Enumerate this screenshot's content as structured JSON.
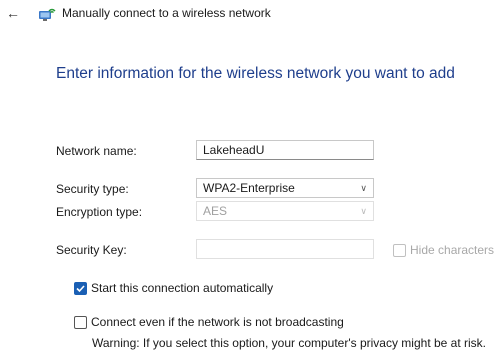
{
  "header": {
    "back_icon": "back-arrow-icon",
    "app_icon": "network-icon",
    "title": "Manually connect to a wireless network"
  },
  "main": {
    "heading": "Enter information for the wireless network you want to add",
    "network_name": {
      "label": "Network name:",
      "value": "LakeheadU"
    },
    "security_type": {
      "label": "Security type:",
      "value": "WPA2-Enterprise"
    },
    "encryption_type": {
      "label": "Encryption type:",
      "value": "AES"
    },
    "security_key": {
      "label": "Security Key:",
      "value": ""
    },
    "hide_characters": {
      "label": "Hide characters",
      "checked": false
    },
    "start_auto": {
      "label": "Start this connection automatically",
      "checked": true
    },
    "connect_broadcast": {
      "label": "Connect even if the network is not broadcasting",
      "checked": false
    },
    "warning": "Warning: If you select this option, your computer's privacy might be at risk."
  },
  "colors": {
    "accent": "#1a5fb4",
    "heading": "#1e3e8c"
  }
}
